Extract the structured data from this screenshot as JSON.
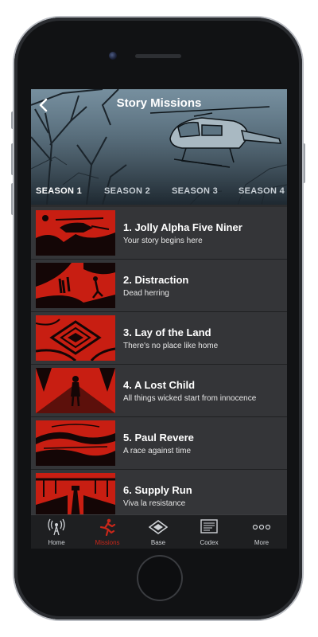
{
  "header": {
    "title": "Story Missions",
    "back_icon": "chevron-left-icon"
  },
  "seasons": [
    {
      "label": "SEASON 1",
      "active": true
    },
    {
      "label": "SEASON 2",
      "active": false
    },
    {
      "label": "SEASON 3",
      "active": false
    },
    {
      "label": "SEASON 4",
      "active": false
    }
  ],
  "missions": [
    {
      "title": "1. Jolly Alpha Five Niner",
      "subtitle": "Your story begins here",
      "thumb": "helicopter"
    },
    {
      "title": "2. Distraction",
      "subtitle": "Dead herring",
      "thumb": "runners"
    },
    {
      "title": "3. Lay of the Land",
      "subtitle": "There's no place like home",
      "thumb": "aerial-map"
    },
    {
      "title": "4. A Lost Child",
      "subtitle": "All things wicked start from innocence",
      "thumb": "girl"
    },
    {
      "title": "5. Paul Revere",
      "subtitle": "A race against time",
      "thumb": "landscape"
    },
    {
      "title": "6. Supply Run",
      "subtitle": "Viva la resistance",
      "thumb": "road"
    }
  ],
  "tabbar": [
    {
      "label": "Home",
      "icon": "radio-tower-icon",
      "active": false
    },
    {
      "label": "Missions",
      "icon": "running-man-icon",
      "active": true
    },
    {
      "label": "Base",
      "icon": "base-icon",
      "active": false
    },
    {
      "label": "Codex",
      "icon": "codex-icon",
      "active": false
    },
    {
      "label": "More",
      "icon": "more-icon",
      "active": false
    }
  ],
  "colors": {
    "accent": "#c8271a",
    "thumb_red": "#c81e12",
    "row_bg": "#343538",
    "tabbar_bg": "#1e1f21"
  }
}
